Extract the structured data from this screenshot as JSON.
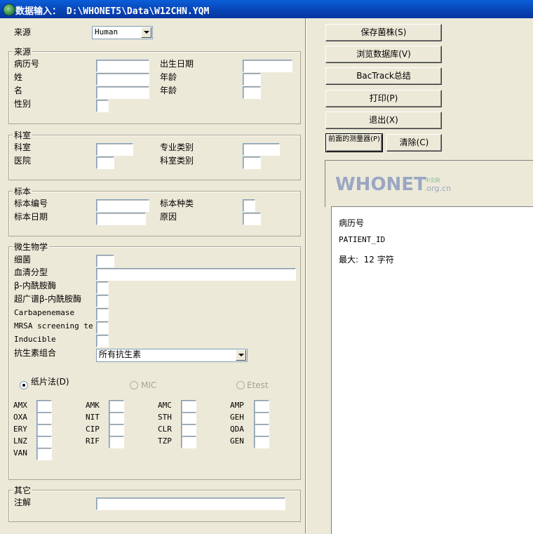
{
  "window": {
    "title": "数据输入： D:\\WHONET5\\Data\\W12CHN.YQM"
  },
  "top": {
    "origin_label": "来源",
    "origin_value": "Human"
  },
  "source_group": {
    "title": "来源",
    "patient_id": "病历号",
    "last_name": "姓",
    "first_name": "名",
    "sex": "性别",
    "birth_date": "出生日期",
    "age1": "年龄",
    "age2": "年龄"
  },
  "dept_group": {
    "title": "科室",
    "ward": "科室",
    "hospital": "医院",
    "specialty": "专业类别",
    "ward_type": "科室类别"
  },
  "specimen_group": {
    "title": "标本",
    "spec_num": "标本编号",
    "spec_date": "标本日期",
    "spec_type": "标本种类",
    "reason": "原因"
  },
  "micro_group": {
    "title": "微生物学",
    "organism": "细菌",
    "serotype": "血清分型",
    "beta": "β-内酰胺酶",
    "esbl": "超广谱β-内酰胺酶",
    "carba": "Carbapenemase",
    "mrsa": "MRSA screening te",
    "inducible": "Inducible",
    "panel_label": "抗生素组合",
    "panel_value": "所有抗生素",
    "method_disk": "纸片法(D)",
    "method_mic": "MIC",
    "method_etest": "Etest",
    "antibiotics": [
      [
        "AMX",
        "OXA",
        "ERY",
        "LNZ",
        "VAN"
      ],
      [
        "AMK",
        "NIT",
        "CIP",
        "RIF"
      ],
      [
        "AMC",
        "STH",
        "CLR",
        "TZP"
      ],
      [
        "AMP",
        "GEH",
        "QDA",
        "GEN"
      ]
    ]
  },
  "other_group": {
    "title": "其它",
    "comment": "注解"
  },
  "buttons": {
    "save": "保存菌株(S)",
    "browse": "浏览数据库(V)",
    "bactrack": "BacTrack总结",
    "print": "打印(P)",
    "exit": "退出(X)",
    "prev": "前面的测量器(P)",
    "clear": "清除(C)"
  },
  "logo": {
    "main": "WHONET",
    "sub": ".org.cn",
    "cn": "中文网"
  },
  "info": {
    "name": "病历号",
    "code": "PATIENT_ID",
    "max": "最大:  12 字符"
  }
}
